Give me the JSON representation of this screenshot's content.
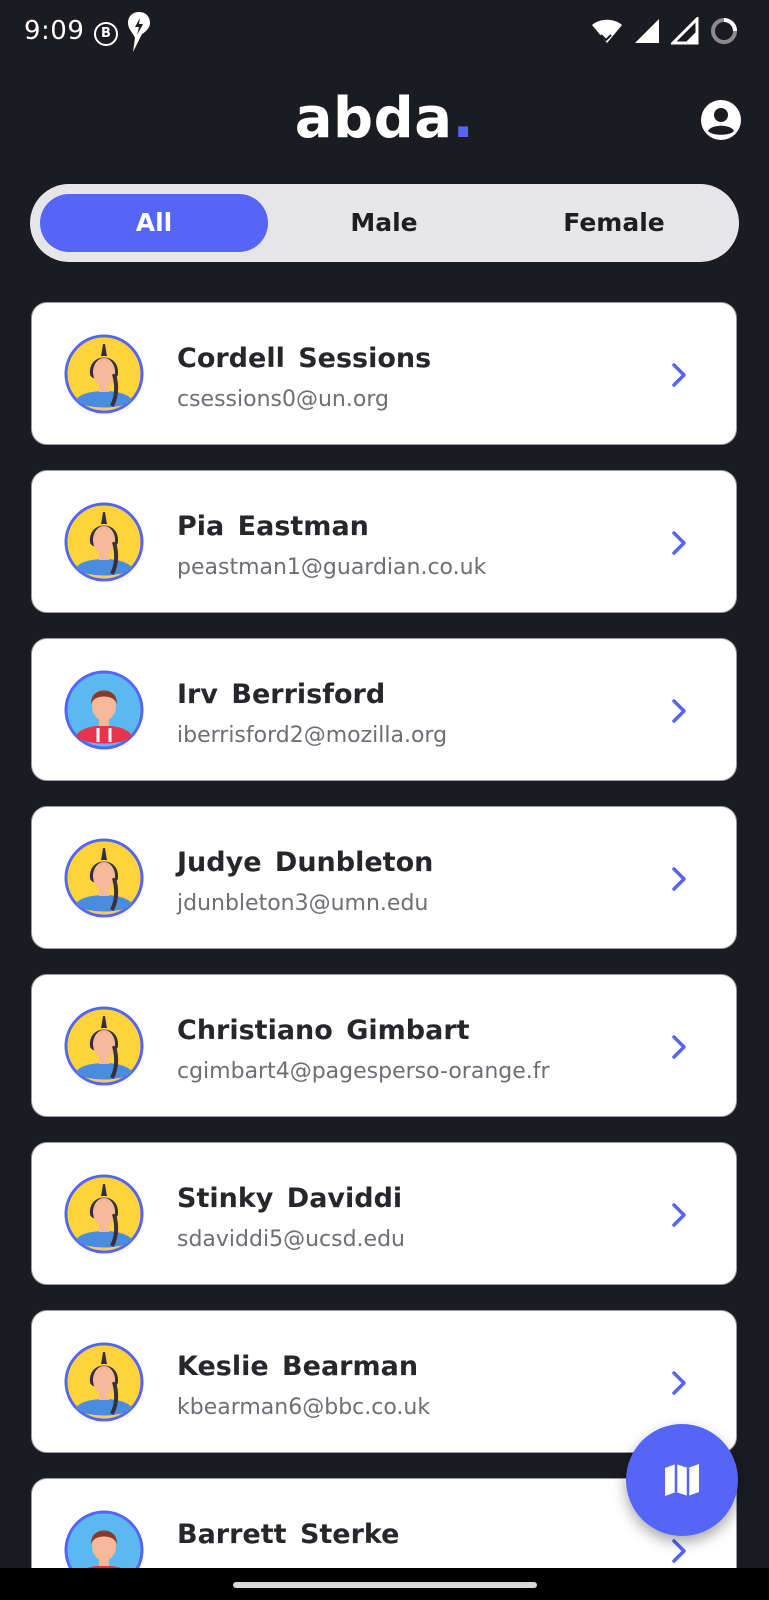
{
  "status_bar": {
    "time": "9:09",
    "b_badge": "B"
  },
  "header": {
    "brand": "abda",
    "brand_dot": "."
  },
  "filter": {
    "options": [
      "All",
      "Male",
      "Female"
    ],
    "selected": "All"
  },
  "users": [
    {
      "name": "Cordell  Sessions",
      "email": "csessions0@un.org",
      "avatar": "female-avatar-icon"
    },
    {
      "name": "Pia  Eastman",
      "email": "peastman1@guardian.co.uk",
      "avatar": "female-avatar-icon"
    },
    {
      "name": "Irv  Berrisford",
      "email": "iberrisford2@mozilla.org",
      "avatar": "male-avatar-icon"
    },
    {
      "name": "Judye  Dunbleton",
      "email": "jdunbleton3@umn.edu",
      "avatar": "female-avatar-icon"
    },
    {
      "name": "Christiano  Gimbart",
      "email": "cgimbart4@pagesperso-orange.fr",
      "avatar": "female-avatar-icon"
    },
    {
      "name": "Stinky  Daviddi",
      "email": "sdaviddi5@ucsd.edu",
      "avatar": "female-avatar-icon"
    },
    {
      "name": "Keslie  Bearman",
      "email": "kbearman6@bbc.co.uk",
      "avatar": "female-avatar-icon"
    },
    {
      "name": "Barrett  Sterke",
      "email": "",
      "avatar": "male-avatar-icon"
    }
  ],
  "icons": {
    "account": "account-circle-icon",
    "chevron": "chevron-right-icon",
    "fab": "map-icon"
  },
  "colors": {
    "accent": "#5565f7",
    "background": "#1b1c21",
    "card": "#ffffff"
  }
}
